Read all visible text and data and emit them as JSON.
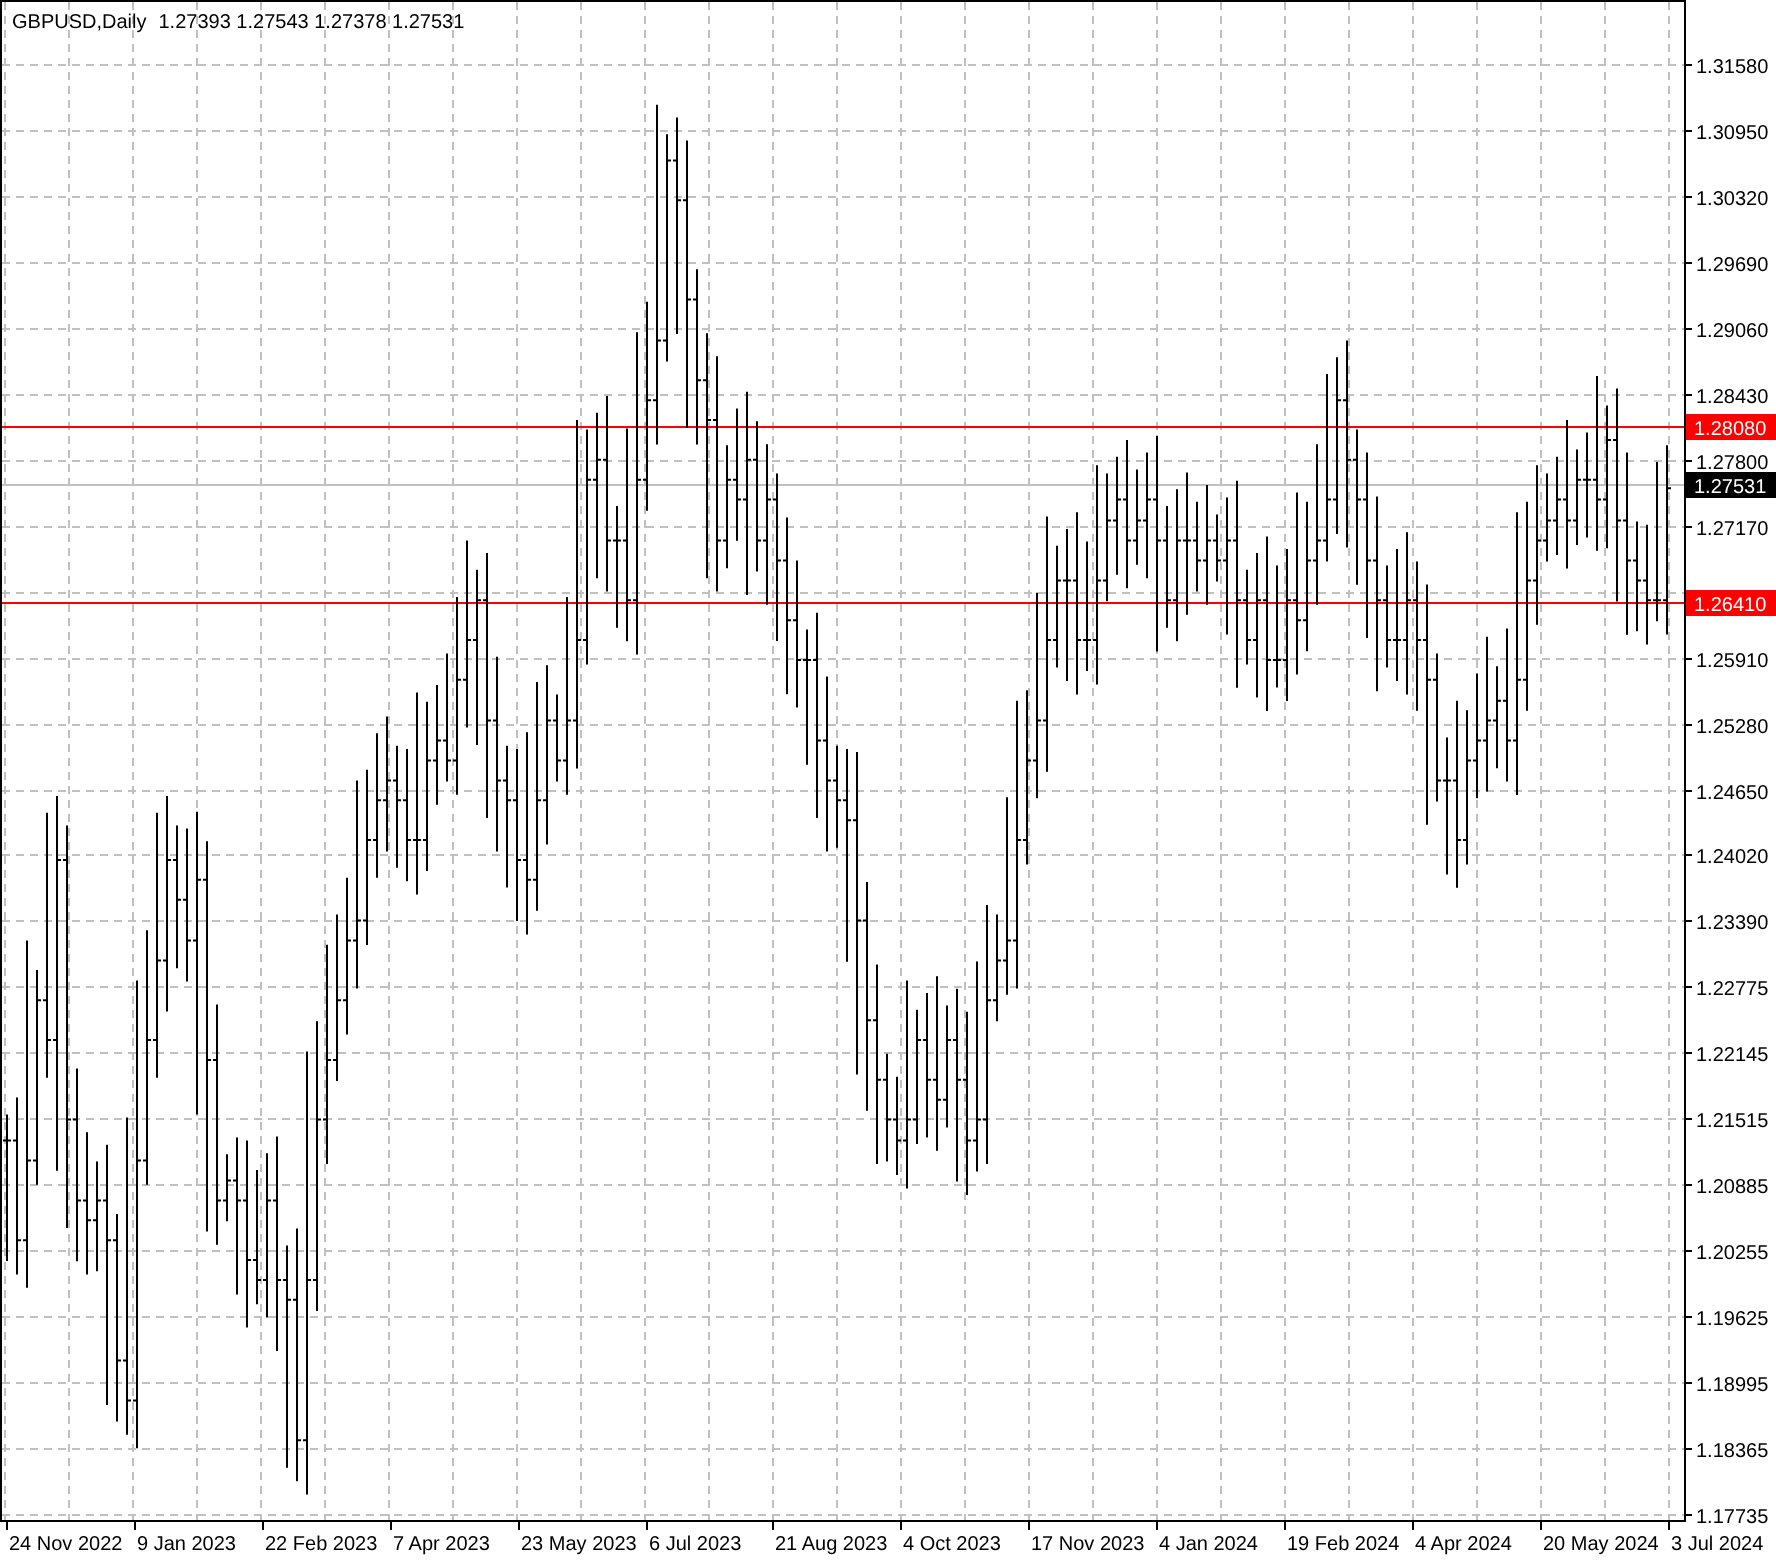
{
  "chart": {
    "title": "GBPUSD,Daily",
    "quote": "1.27393 1.27543 1.27378 1.27531",
    "price_labels": [
      "1.31580",
      "1.30950",
      "1.30320",
      "1.29690",
      "1.29060",
      "1.28430",
      "1.27800",
      "1.27170",
      "1.25910",
      "1.25280",
      "1.24650",
      "1.24020",
      "1.23390",
      "1.22775",
      "1.22145",
      "1.21515",
      "1.20885",
      "1.20255",
      "1.19625",
      "1.18995",
      "1.18365",
      "1.17735"
    ],
    "date_labels": [
      "24 Nov 2022",
      "9 Jan 2023",
      "22 Feb 2023",
      "7 Apr 2023",
      "23 May 2023",
      "6 Jul 2023",
      "21 Aug 2023",
      "4 Oct 2023",
      "17 Nov 2023",
      "4 Jan 2024",
      "19 Feb 2024",
      "4 Apr 2024",
      "20 May 2024",
      "3 Jul 2024"
    ],
    "price_tags": [
      {
        "kind": "level",
        "label": "1.28080"
      },
      {
        "kind": "current",
        "label": "1.27531"
      },
      {
        "kind": "level",
        "label": "1.26410"
      }
    ]
  }
}
